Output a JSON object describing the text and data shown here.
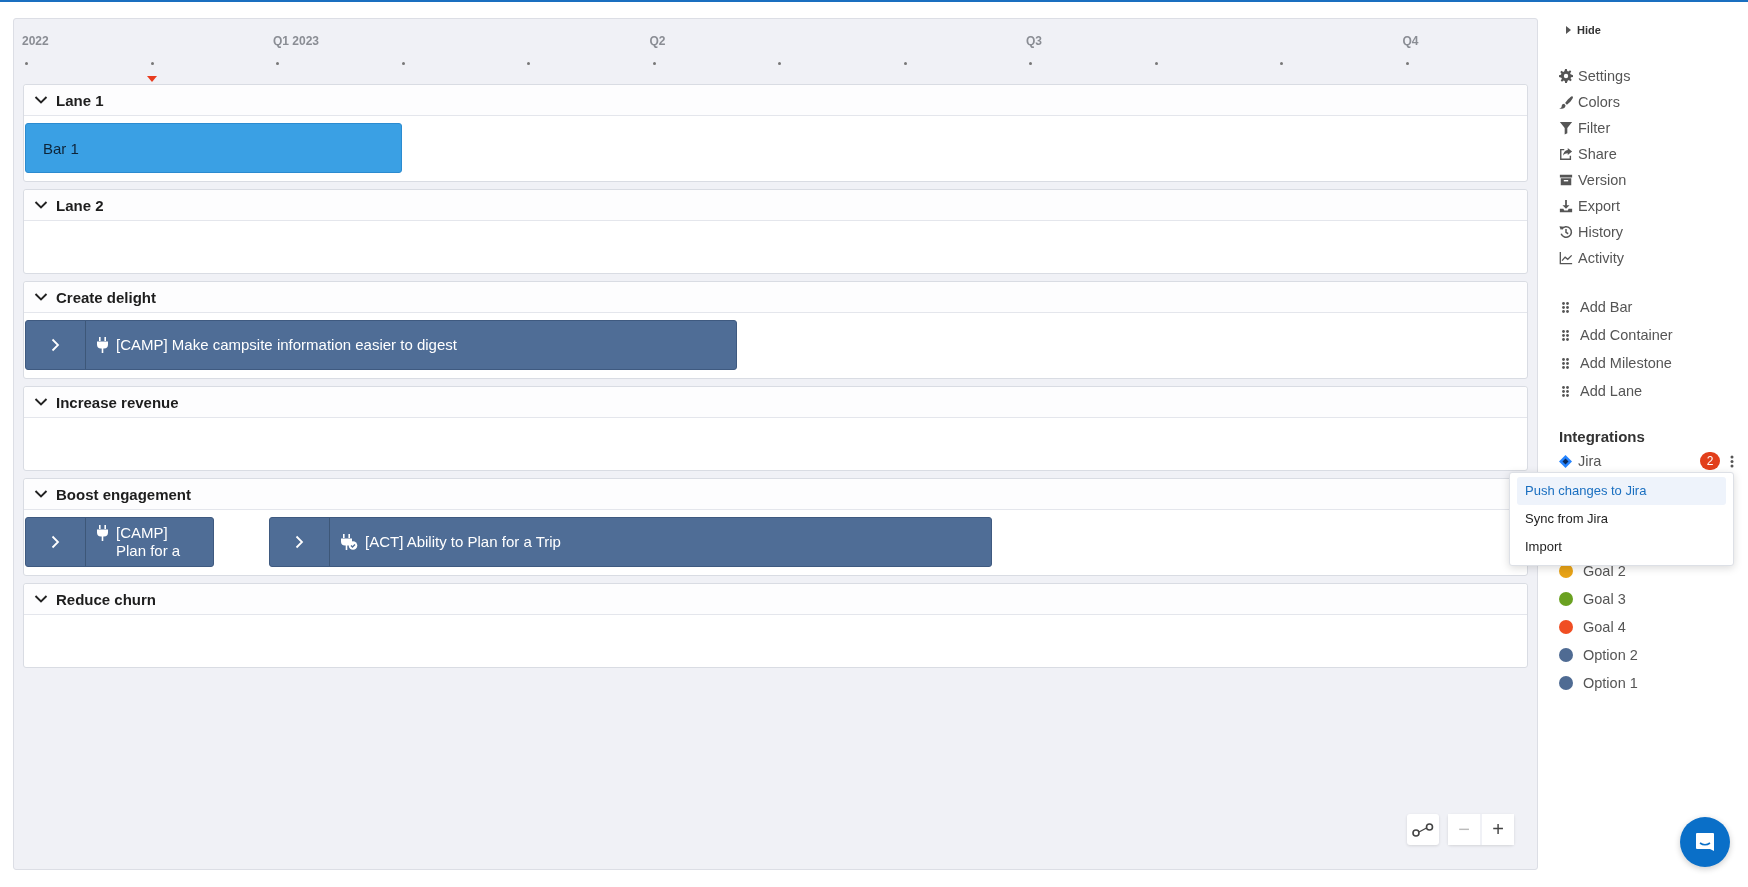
{
  "timeline": {
    "ticks": [
      {
        "label": "2022",
        "today": false
      },
      {
        "today": true
      },
      {
        "label": "Q1 2023",
        "today": false
      },
      {
        "today": false
      },
      {
        "today": false
      },
      {
        "label": "Q2",
        "today": false
      },
      {
        "today": false
      },
      {
        "today": false
      },
      {
        "label": "Q3",
        "today": false
      },
      {
        "today": false
      },
      {
        "today": false
      },
      {
        "label": "Q4",
        "today": false
      }
    ]
  },
  "lanes": [
    {
      "title": "Lane 1",
      "expanded": true,
      "bars": [
        {
          "kind": "bar",
          "label": "Bar 1"
        }
      ]
    },
    {
      "title": "Lane 2",
      "expanded": true
    },
    {
      "title": "Create delight",
      "expanded": true,
      "bars": [
        {
          "kind": "container",
          "label": "[CAMP] Make campsite information easier to digest"
        }
      ]
    },
    {
      "title": "Increase revenue",
      "expanded": true
    },
    {
      "title": "Boost engagement",
      "expanded": true,
      "bars": [
        {
          "kind": "container",
          "label": "[CAMP] Plan for a"
        },
        {
          "kind": "container",
          "label": "[ACT] Ability to Plan for a Trip"
        }
      ]
    },
    {
      "title": "Reduce churn",
      "expanded": true
    }
  ],
  "zoom_controls": [
    {
      "symbol": "−",
      "disabled": true
    },
    {
      "symbol": "+",
      "disabled": false
    }
  ],
  "sidebar": {
    "hide_label": "Hide",
    "menu": [
      {
        "label": "Settings"
      },
      {
        "label": "Colors"
      },
      {
        "label": "Filter"
      },
      {
        "label": "Share"
      },
      {
        "label": "Version"
      },
      {
        "label": "Export"
      },
      {
        "label": "History"
      },
      {
        "label": "Activity"
      }
    ],
    "add_items": [
      "Add Bar",
      "Add Container",
      "Add Milestone",
      "Add Lane"
    ],
    "integrations": {
      "title": "Integrations",
      "items": [
        {
          "label": "Jira",
          "badge": "2"
        }
      ]
    },
    "integration_menu": [
      {
        "label": "Push changes to Jira",
        "selected": true
      },
      {
        "label": "Sync from Jira",
        "selected": false
      },
      {
        "label": "Import",
        "selected": false
      }
    ],
    "legend": [
      {
        "label": "Goal 2",
        "color": "#e8a317"
      },
      {
        "label": "Goal 3",
        "color": "#6aa121"
      },
      {
        "label": "Goal 4",
        "color": "#f04e23"
      },
      {
        "label": "Option 2",
        "color": "#4f6b93"
      },
      {
        "label": "Option 1",
        "color": "#4f6b93"
      }
    ]
  }
}
